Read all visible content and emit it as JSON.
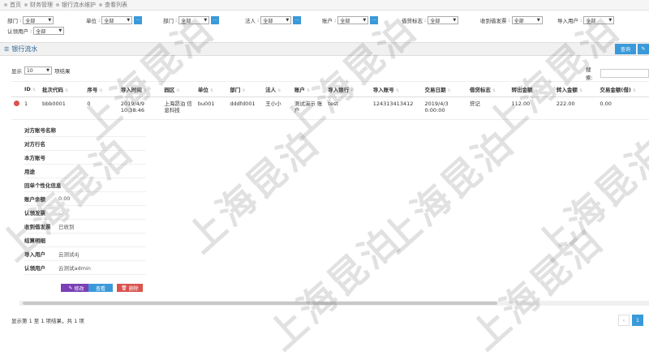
{
  "breadcrumb": [
    "首页",
    "财务管理",
    "银行流水维护",
    "查看列表"
  ],
  "filters": [
    {
      "label": "部门",
      "value": "全部"
    },
    {
      "label": "单位",
      "value": "全部"
    },
    {
      "label": "部门",
      "value": "全部"
    },
    {
      "label": "法人",
      "value": "全部"
    },
    {
      "label": "账户",
      "value": "全部"
    },
    {
      "label": "借贷标志",
      "value": "全部"
    },
    {
      "label": "收到借发票",
      "value": "全部"
    },
    {
      "label": "导入用户",
      "value": "全部"
    },
    {
      "label": "认领用户",
      "value": "全部"
    }
  ],
  "panel_title": "银行流水",
  "toolbar": {
    "query": "查询",
    "edit_icon": "pencil-icon"
  },
  "length": {
    "prefix": "显示",
    "value": "10",
    "suffix": "项结果"
  },
  "search_label": "搜索:",
  "columns": [
    "ID",
    "批次代码",
    "序号",
    "导入时间",
    "园区",
    "单位",
    "部门",
    "法人",
    "账户",
    "导入银行",
    "导入账号",
    "交易日期",
    "借贷标志",
    "转出金额",
    "转入金额",
    "交易金额(借)"
  ],
  "rows": [
    [
      "1",
      "bbb0001",
      "0",
      "2019/4/9 10:38:46",
      "上海昂泊 信息科技",
      "bu001",
      "dddfd001",
      "王小小",
      "测试演示 账户",
      "test",
      "124313413412",
      "2019/4/3 0:00:00",
      "贷记",
      "112.00",
      "222.00",
      "0.00"
    ]
  ],
  "detail": [
    {
      "k": "对方账号名称",
      "v": ""
    },
    {
      "k": "对方行名",
      "v": ""
    },
    {
      "k": "本方账号",
      "v": ""
    },
    {
      "k": "用途",
      "v": ""
    },
    {
      "k": "回单个性化信息",
      "v": ""
    },
    {
      "k": "账户余额",
      "v": "0.00"
    },
    {
      "k": "认领发票",
      "v": ""
    },
    {
      "k": "收到借发票",
      "v": "已收到"
    },
    {
      "k": "结算明细",
      "v": ""
    },
    {
      "k": "导入用户",
      "v": "云测试dj"
    },
    {
      "k": "认领用户",
      "v": "云测试admin"
    }
  ],
  "actions": {
    "edit": "修改",
    "view": "查看",
    "delete": "删除"
  },
  "info": "显示第 1 至 1 项结果，共 1 项",
  "pager": {
    "prev": "‹",
    "current": "1"
  },
  "watermark": "上海昆泊",
  "colors": {
    "primary": "#3a9ad9",
    "purple": "#7b3fb6",
    "danger": "#d9534f"
  }
}
